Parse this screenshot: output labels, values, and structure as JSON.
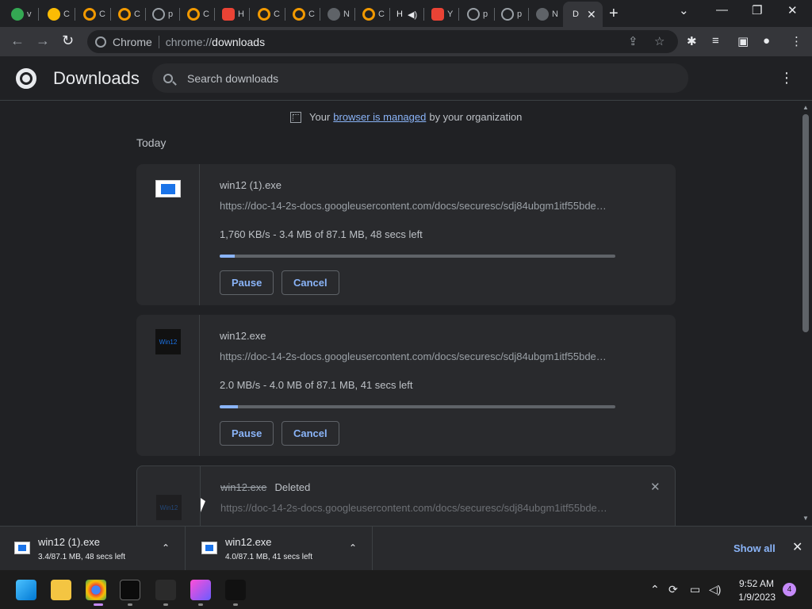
{
  "tabs": [
    {
      "label": "v",
      "color": "#34a853"
    },
    {
      "label": "C",
      "color": "#fbbc04"
    },
    {
      "label": "C",
      "color": "#f28b82"
    },
    {
      "label": "C",
      "color": "#f28b82"
    },
    {
      "label": "p",
      "color": "#9aa0a6"
    },
    {
      "label": "C",
      "color": "#f28b82"
    },
    {
      "label": "H",
      "color": "#ea4335"
    },
    {
      "label": "C",
      "color": "#f28b82"
    },
    {
      "label": "C",
      "color": "#f28b82"
    },
    {
      "label": "N",
      "color": "#81c995"
    },
    {
      "label": "C",
      "color": "#f28b82"
    },
    {
      "label": "H",
      "color": "#e8eaed"
    },
    {
      "label": "Y",
      "color": "#ea4335"
    },
    {
      "label": "p",
      "color": "#9aa0a6"
    },
    {
      "label": "p",
      "color": "#9aa0a6"
    },
    {
      "label": "N",
      "color": "#81c995"
    }
  ],
  "active_tab": {
    "label": "D"
  },
  "window_controls": {
    "chevron": "⌄",
    "minimize": "—",
    "restore": "❐",
    "close": "✕"
  },
  "omnibox": {
    "site": "Chrome",
    "scheme": "chrome://",
    "host": "downloads"
  },
  "header": {
    "title": "Downloads",
    "search_placeholder": "Search downloads"
  },
  "managed_notice": {
    "prefix": "Your",
    "link": "browser is managed",
    "suffix": "by your organization"
  },
  "date_heading": "Today",
  "downloads": [
    {
      "name": "win12 (1).exe",
      "url": "https://doc-14-2s-docs.googleusercontent.com/docs/securesc/sdj84ubgm1itf55bde…",
      "status": "1,760 KB/s - 3.4 MB of 87.1 MB, 48 secs left",
      "progress": 0.039,
      "pause_label": "Pause",
      "cancel_label": "Cancel"
    },
    {
      "name": "win12.exe",
      "url": "https://doc-14-2s-docs.googleusercontent.com/docs/securesc/sdj84ubgm1itf55bde…",
      "status": "2.0 MB/s - 4.0 MB of 87.1 MB, 41 secs left",
      "progress": 0.046,
      "pause_label": "Pause",
      "cancel_label": "Cancel",
      "thumb_text": "Win12"
    },
    {
      "name": "win12.exe",
      "deleted_label": "Deleted",
      "url": "https://doc-14-2s-docs.googleusercontent.com/docs/securesc/sdj84ubgm1itf55bde…",
      "thumb_text": "Win12"
    }
  ],
  "shelf": {
    "items": [
      {
        "name": "win12 (1).exe",
        "status": "3.4/87.1 MB, 48 secs left"
      },
      {
        "name": "win12.exe",
        "status": "4.0/87.1 MB, 41 secs left"
      }
    ],
    "show_all": "Show all"
  },
  "taskbar": {
    "time": "9:52 AM",
    "date": "1/9/2023",
    "notifications": "4"
  }
}
